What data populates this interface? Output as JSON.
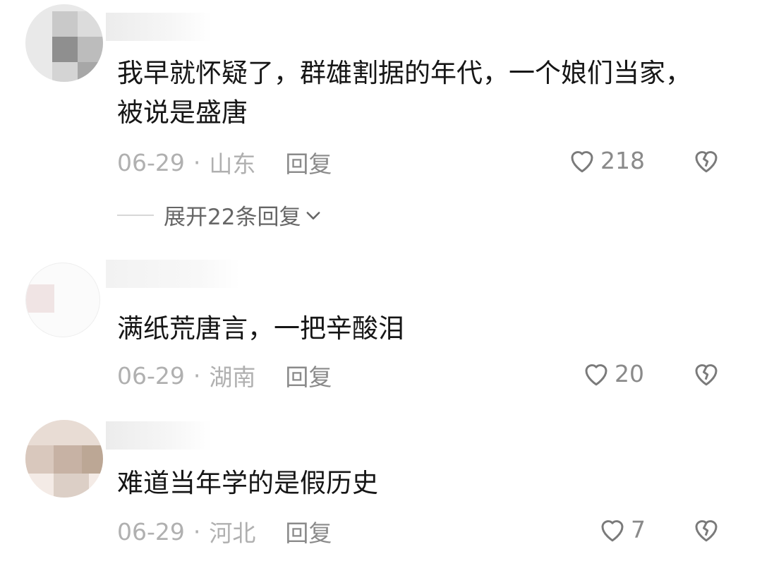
{
  "comments": [
    {
      "text": "我早就怀疑了，群雄割据的年代，一个娘们当家，被说是盛唐",
      "date": "06-29",
      "sep": "·",
      "location": "山东",
      "reply": "回复",
      "likes": "218",
      "expand_replies": "展开22条回复"
    },
    {
      "text": "满纸荒唐言，一把辛酸泪",
      "date": "06-29",
      "sep": "·",
      "location": "湖南",
      "reply": "回复",
      "likes": "20"
    },
    {
      "text": "难道当年学的是假历史",
      "date": "06-29",
      "sep": "·",
      "location": "河北",
      "reply": "回复",
      "likes": "7"
    }
  ],
  "icons": {
    "like": "heart-icon",
    "dislike": "broken-heart-icon",
    "expand": "chevron-down-icon"
  }
}
